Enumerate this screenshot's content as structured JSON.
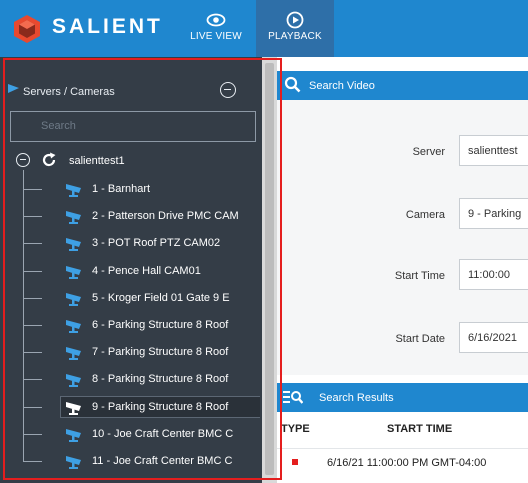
{
  "app": {
    "brand": "SALIENT",
    "accent": "#1f87cf"
  },
  "nav": {
    "live_view": "LIVE VIEW",
    "playback": "PLAYBACK"
  },
  "tree": {
    "header": "Servers / Cameras",
    "search_placeholder": "Search",
    "server": "salienttest1",
    "cameras": [
      "1 - Barnhart",
      "2 - Patterson Drive PMC CAM",
      "3 - POT Roof PTZ CAM02",
      "4 - Pence Hall CAM01",
      "5 - Kroger Field 01 Gate 9 E",
      "6 - Parking Structure 8 Roof",
      "7 - Parking Structure 8 Roof",
      "8 - Parking Structure 8 Roof",
      "9 - Parking Structure 8 Roof",
      "10 - Joe Craft Center BMC C",
      "11 - Joe Craft Center BMC C"
    ],
    "selected_index": 8
  },
  "search_video": {
    "title": "Search Video",
    "server_label": "Server",
    "server_value": "salienttest",
    "camera_label": "Camera",
    "camera_value": "9 - Parking",
    "start_time_label": "Start Time",
    "start_time_value": "11:00:00",
    "start_date_label": "Start Date",
    "start_date_value": "6/16/2021"
  },
  "search_results": {
    "title": "Search Results",
    "columns": [
      "TYPE",
      "START TIME"
    ],
    "rows": [
      {
        "type_color": "#e41e1e",
        "start_time": "6/16/21 11:00:00 PM GMT-04:00"
      }
    ]
  }
}
